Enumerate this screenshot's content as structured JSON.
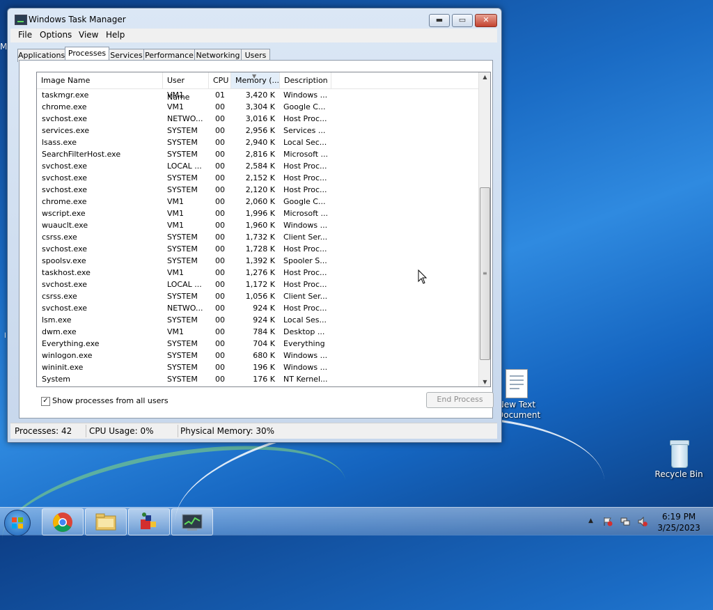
{
  "window": {
    "title": "Windows Task Manager",
    "controls": {
      "minimize": "▬",
      "maximize": "▭",
      "close": "✕"
    }
  },
  "menu": [
    "File",
    "Options",
    "View",
    "Help"
  ],
  "tabs": [
    "Applications",
    "Processes",
    "Services",
    "Performance",
    "Networking",
    "Users"
  ],
  "active_tab": "Processes",
  "columns": [
    "Image Name",
    "User Name",
    "CPU",
    "Memory (...",
    "Description"
  ],
  "sorted_column": "Memory (...",
  "processes": [
    {
      "name": "taskmgr.exe",
      "user": "VM1",
      "cpu": "01",
      "mem": "3,420 K",
      "desc": "Windows ..."
    },
    {
      "name": "chrome.exe",
      "user": "VM1",
      "cpu": "00",
      "mem": "3,304 K",
      "desc": "Google C..."
    },
    {
      "name": "svchost.exe",
      "user": "NETWO...",
      "cpu": "00",
      "mem": "3,016 K",
      "desc": "Host Proc..."
    },
    {
      "name": "services.exe",
      "user": "SYSTEM",
      "cpu": "00",
      "mem": "2,956 K",
      "desc": "Services ..."
    },
    {
      "name": "lsass.exe",
      "user": "SYSTEM",
      "cpu": "00",
      "mem": "2,940 K",
      "desc": "Local Sec..."
    },
    {
      "name": "SearchFilterHost.exe",
      "user": "SYSTEM",
      "cpu": "00",
      "mem": "2,816 K",
      "desc": "Microsoft ..."
    },
    {
      "name": "svchost.exe",
      "user": "LOCAL ...",
      "cpu": "00",
      "mem": "2,584 K",
      "desc": "Host Proc..."
    },
    {
      "name": "svchost.exe",
      "user": "SYSTEM",
      "cpu": "00",
      "mem": "2,152 K",
      "desc": "Host Proc..."
    },
    {
      "name": "svchost.exe",
      "user": "SYSTEM",
      "cpu": "00",
      "mem": "2,120 K",
      "desc": "Host Proc..."
    },
    {
      "name": "chrome.exe",
      "user": "VM1",
      "cpu": "00",
      "mem": "2,060 K",
      "desc": "Google C..."
    },
    {
      "name": "wscript.exe",
      "user": "VM1",
      "cpu": "00",
      "mem": "1,996 K",
      "desc": "Microsoft ..."
    },
    {
      "name": "wuauclt.exe",
      "user": "VM1",
      "cpu": "00",
      "mem": "1,960 K",
      "desc": "Windows ..."
    },
    {
      "name": "csrss.exe",
      "user": "SYSTEM",
      "cpu": "00",
      "mem": "1,732 K",
      "desc": "Client Ser..."
    },
    {
      "name": "svchost.exe",
      "user": "SYSTEM",
      "cpu": "00",
      "mem": "1,728 K",
      "desc": "Host Proc..."
    },
    {
      "name": "spoolsv.exe",
      "user": "SYSTEM",
      "cpu": "00",
      "mem": "1,392 K",
      "desc": "Spooler S..."
    },
    {
      "name": "taskhost.exe",
      "user": "VM1",
      "cpu": "00",
      "mem": "1,276 K",
      "desc": "Host Proc..."
    },
    {
      "name": "svchost.exe",
      "user": "LOCAL ...",
      "cpu": "00",
      "mem": "1,172 K",
      "desc": "Host Proc..."
    },
    {
      "name": "csrss.exe",
      "user": "SYSTEM",
      "cpu": "00",
      "mem": "1,056 K",
      "desc": "Client Ser..."
    },
    {
      "name": "svchost.exe",
      "user": "NETWO...",
      "cpu": "00",
      "mem": "924 K",
      "desc": "Host Proc..."
    },
    {
      "name": "lsm.exe",
      "user": "SYSTEM",
      "cpu": "00",
      "mem": "924 K",
      "desc": "Local Ses..."
    },
    {
      "name": "dwm.exe",
      "user": "VM1",
      "cpu": "00",
      "mem": "784 K",
      "desc": "Desktop ..."
    },
    {
      "name": "Everything.exe",
      "user": "SYSTEM",
      "cpu": "00",
      "mem": "704 K",
      "desc": "Everything"
    },
    {
      "name": "winlogon.exe",
      "user": "SYSTEM",
      "cpu": "00",
      "mem": "680 K",
      "desc": "Windows ..."
    },
    {
      "name": "wininit.exe",
      "user": "SYSTEM",
      "cpu": "00",
      "mem": "196 K",
      "desc": "Windows ..."
    },
    {
      "name": "System",
      "user": "SYSTEM",
      "cpu": "00",
      "mem": "176 K",
      "desc": "NT Kernel..."
    }
  ],
  "show_all_users": {
    "label": "Show processes from all users",
    "checked": true,
    "mark": "✓"
  },
  "end_process_label": "End Process",
  "status": {
    "processes": "Processes: 42",
    "cpu": "CPU Usage: 0%",
    "memory": "Physical Memory: 30%"
  },
  "desktop": {
    "icons": [
      {
        "label": "New Text Document"
      },
      {
        "label": "Recycle Bin"
      }
    ],
    "left_edge_letters": [
      "M",
      "l"
    ]
  },
  "taskbar": {
    "pinned": [
      "chrome-icon",
      "explorer-folder-icon",
      "app-blocks-icon",
      "task-manager-icon"
    ],
    "time": "6:19 PM",
    "date": "3/25/2023",
    "tray_arrow": "▲"
  }
}
